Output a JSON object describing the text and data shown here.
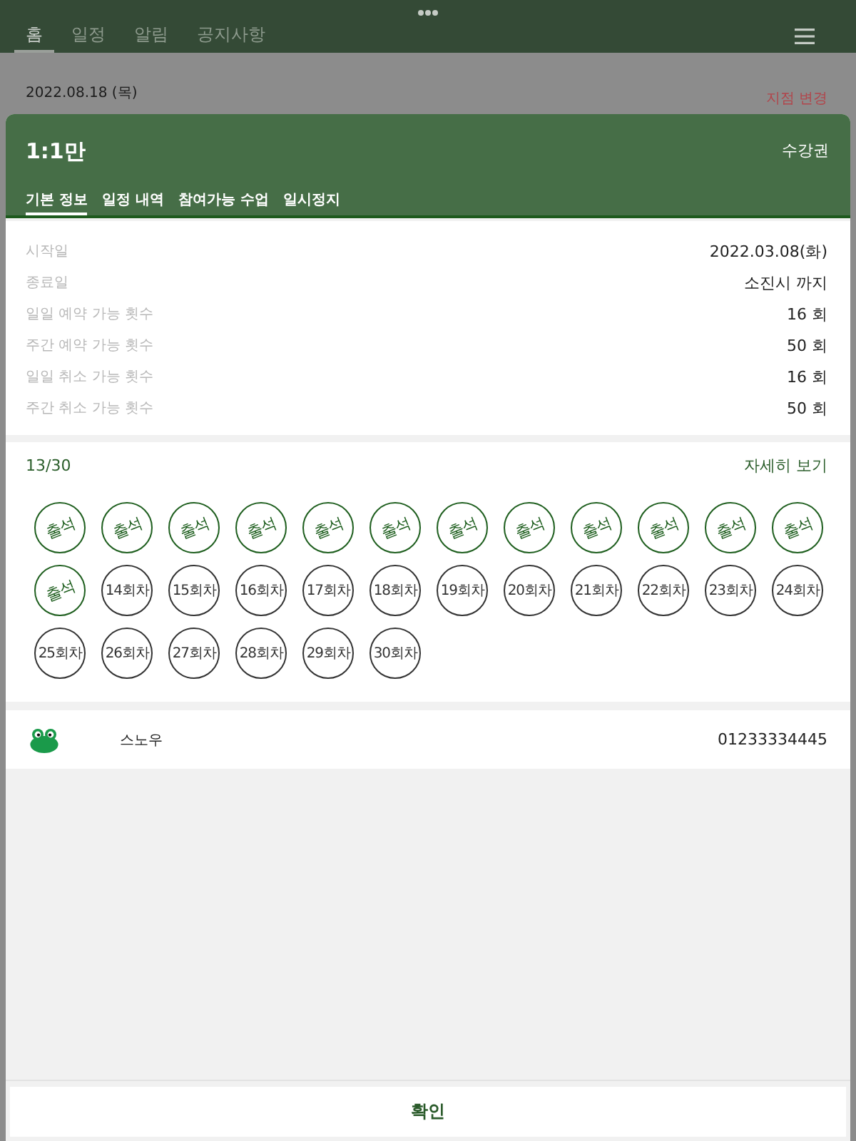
{
  "top_nav": {
    "tabs": [
      {
        "label": "홈",
        "selected": true
      },
      {
        "label": "일정",
        "selected": false
      },
      {
        "label": "알림",
        "selected": false
      },
      {
        "label": "공지사항",
        "selected": false
      }
    ]
  },
  "date_bar": {
    "date": "2022.08.18 (목)",
    "branch_change": "지점 변경"
  },
  "sheet": {
    "title": "1:1만",
    "pass_type": "수강권",
    "tabs": [
      {
        "label": "기본 정보",
        "selected": true
      },
      {
        "label": "일정 내역",
        "selected": false
      },
      {
        "label": "참여가능 수업",
        "selected": false
      },
      {
        "label": "일시정지",
        "selected": false
      }
    ],
    "info_rows": [
      {
        "label": "시작일",
        "value": "2022.03.08(화)"
      },
      {
        "label": "종료일",
        "value": "소진시 까지"
      },
      {
        "label": "일일 예약 가능 횟수",
        "value": "16 회"
      },
      {
        "label": "주간 예약 가능 횟수",
        "value": "50 회"
      },
      {
        "label": "일일 취소 가능 횟수",
        "value": "16 회"
      },
      {
        "label": "주간 취소 가능 횟수",
        "value": "50 회"
      }
    ],
    "attendance": {
      "count": "13/30",
      "details_link": "자세히 보기",
      "sessions": [
        {
          "label": "출석",
          "attended": true
        },
        {
          "label": "출석",
          "attended": true
        },
        {
          "label": "출석",
          "attended": true
        },
        {
          "label": "출석",
          "attended": true
        },
        {
          "label": "출석",
          "attended": true
        },
        {
          "label": "출석",
          "attended": true
        },
        {
          "label": "출석",
          "attended": true
        },
        {
          "label": "출석",
          "attended": true
        },
        {
          "label": "출석",
          "attended": true
        },
        {
          "label": "출석",
          "attended": true
        },
        {
          "label": "출석",
          "attended": true
        },
        {
          "label": "출석",
          "attended": true
        },
        {
          "label": "출석",
          "attended": true
        },
        {
          "label": "14회차",
          "attended": false
        },
        {
          "label": "15회차",
          "attended": false
        },
        {
          "label": "16회차",
          "attended": false
        },
        {
          "label": "17회차",
          "attended": false
        },
        {
          "label": "18회차",
          "attended": false
        },
        {
          "label": "19회차",
          "attended": false
        },
        {
          "label": "20회차",
          "attended": false
        },
        {
          "label": "21회차",
          "attended": false
        },
        {
          "label": "22회차",
          "attended": false
        },
        {
          "label": "23회차",
          "attended": false
        },
        {
          "label": "24회차",
          "attended": false
        },
        {
          "label": "25회차",
          "attended": false
        },
        {
          "label": "26회차",
          "attended": false
        },
        {
          "label": "27회차",
          "attended": false
        },
        {
          "label": "28회차",
          "attended": false
        },
        {
          "label": "29회차",
          "attended": false
        },
        {
          "label": "30회차",
          "attended": false
        }
      ]
    },
    "instructor": {
      "name": "스노우",
      "phone": "01233334445"
    },
    "confirm_button": "확인"
  }
}
